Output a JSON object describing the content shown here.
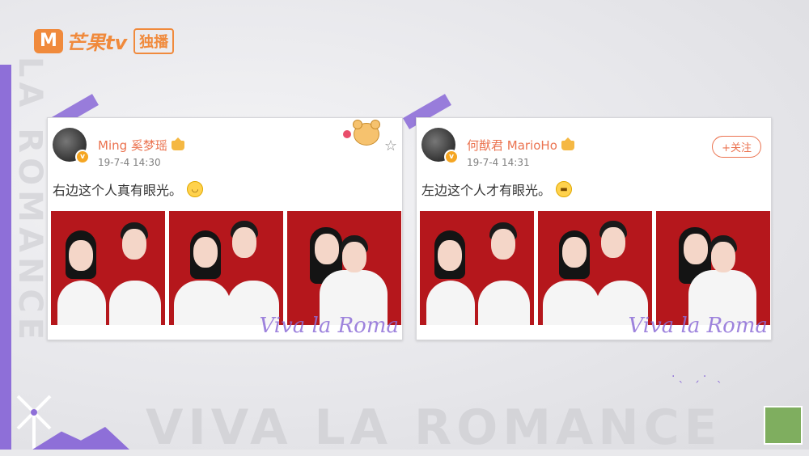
{
  "broadcaster": {
    "logo_letter": "M",
    "name": "芒果tv",
    "exclusive_label": "独播"
  },
  "background": {
    "big_text": "VIVA LA ROMANCE",
    "vertical_text": "LA ROMANCE"
  },
  "posts": [
    {
      "username": "Ming 奚梦瑶",
      "timestamp": "19-7-4 14:30",
      "text": "右边这个人真有眼光。",
      "emoji": "smile-emoji",
      "signature": "Viva la Roma",
      "action": "star-icon"
    },
    {
      "username": "何猷君 MarioHo",
      "timestamp": "19-7-4 14:31",
      "text": "左边这个人才有眼光。",
      "emoji": "cool-emoji",
      "signature": "Viva la Roma",
      "follow_label": "+关注"
    }
  ],
  "colors": {
    "accent_purple": "#8e6fd8",
    "weibo_orange": "#eb7350",
    "photo_red": "#b5171c",
    "logo_orange": "#f08a3c"
  }
}
